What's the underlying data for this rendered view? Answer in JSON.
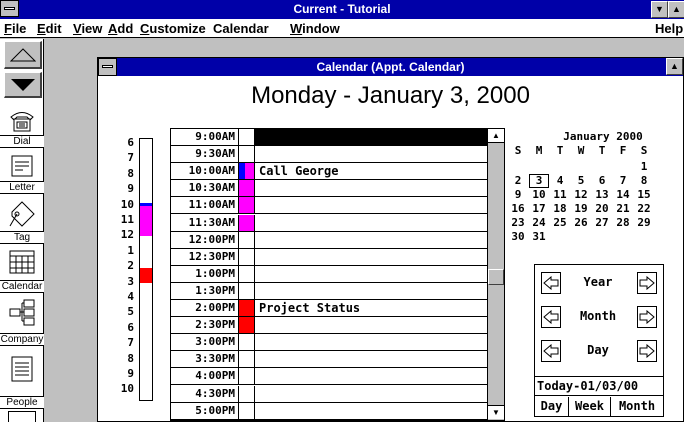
{
  "app": {
    "title": "Current - Tutorial"
  },
  "menu": [
    {
      "label": "File",
      "u": "F",
      "rest": "ile"
    },
    {
      "label": "Edit",
      "u": "E",
      "rest": "dit"
    },
    {
      "label": "View",
      "u": "V",
      "rest": "iew"
    },
    {
      "label": "Add",
      "u": "A",
      "rest": "dd"
    },
    {
      "label": "Customize",
      "u": "C",
      "rest": "ustomize"
    },
    {
      "label": "Calendar",
      "u": "",
      "rest": "Calendar"
    },
    {
      "label": "Window",
      "u": "W",
      "rest": "indow"
    },
    {
      "label": "Help",
      "u": "",
      "rest": "Help"
    }
  ],
  "toolbar": {
    "dial": "Dial",
    "letter": "Letter",
    "tag": "Tag",
    "calendar": "Calendar",
    "company": "Company",
    "people": "People"
  },
  "calendar_window": {
    "title": "Calendar (Appt. Calendar)",
    "date_heading": "Monday - January 3, 2000"
  },
  "hour_ruler": [
    "6",
    "7",
    "8",
    "9",
    "10",
    "11",
    "12",
    "1",
    "2",
    "3",
    "4",
    "5",
    "6",
    "7",
    "8",
    "9",
    "10"
  ],
  "slots": [
    {
      "time": "9:00AM",
      "text": "",
      "mark": "",
      "selected": true
    },
    {
      "time": "9:30AM",
      "text": "",
      "mark": ""
    },
    {
      "time": "10:00AM",
      "text": "Call George",
      "mark": "blue-magenta"
    },
    {
      "time": "10:30AM",
      "text": "",
      "mark": "magenta"
    },
    {
      "time": "11:00AM",
      "text": "",
      "mark": "magenta"
    },
    {
      "time": "11:30AM",
      "text": "",
      "mark": "magenta"
    },
    {
      "time": "12:00PM",
      "text": "",
      "mark": ""
    },
    {
      "time": "12:30PM",
      "text": "",
      "mark": ""
    },
    {
      "time": "1:00PM",
      "text": "",
      "mark": ""
    },
    {
      "time": "1:30PM",
      "text": "",
      "mark": ""
    },
    {
      "time": "2:00PM",
      "text": "Project Status",
      "mark": "red"
    },
    {
      "time": "2:30PM",
      "text": "",
      "mark": "red"
    },
    {
      "time": "3:00PM",
      "text": "",
      "mark": ""
    },
    {
      "time": "3:30PM",
      "text": "",
      "mark": ""
    },
    {
      "time": "4:00PM",
      "text": "",
      "mark": ""
    },
    {
      "time": "4:30PM",
      "text": "",
      "mark": ""
    },
    {
      "time": "5:00PM",
      "text": "",
      "mark": ""
    }
  ],
  "mini_calendar": {
    "month_year": "January 2000",
    "weekdays": [
      "S",
      "M",
      "T",
      "W",
      "T",
      "F",
      "S"
    ],
    "weeks": [
      [
        "",
        "",
        "",
        "",
        "",
        "",
        "1"
      ],
      [
        "2",
        "3",
        "4",
        "5",
        "6",
        "7",
        "8"
      ],
      [
        "9",
        "10",
        "11",
        "12",
        "13",
        "14",
        "15"
      ],
      [
        "16",
        "17",
        "18",
        "19",
        "20",
        "21",
        "22"
      ],
      [
        "23",
        "24",
        "25",
        "26",
        "27",
        "28",
        "29"
      ],
      [
        "30",
        "31",
        "",
        "",
        "",
        "",
        ""
      ]
    ],
    "selected_day": "3"
  },
  "navigator": {
    "year": "Year",
    "month": "Month",
    "day": "Day",
    "today": "Today-01/03/00",
    "views": [
      "Day",
      "Week",
      "Month"
    ]
  },
  "colors": {
    "titlebar": "#0000a8",
    "magenta": "#ff00ff",
    "blue": "#0000ff",
    "red": "#ff0000"
  }
}
